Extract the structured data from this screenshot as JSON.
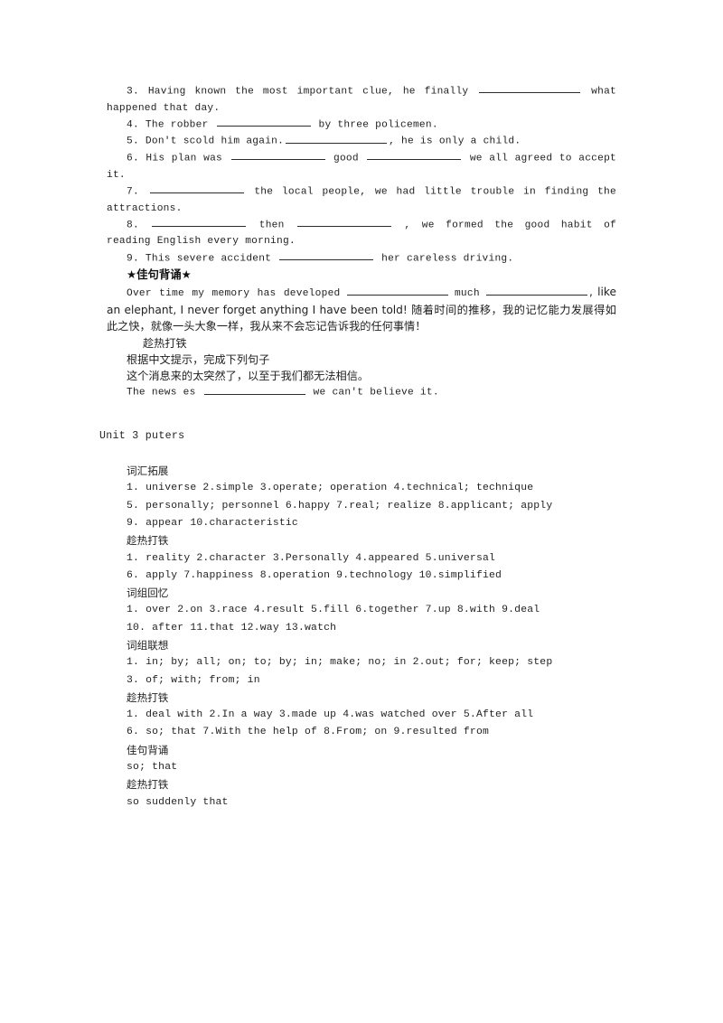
{
  "document": {
    "exercise_block": {
      "items": [
        {
          "number": "3.",
          "pre": "Having known the most important clue, he finally",
          "post": "what happened that day.",
          "blanks": 1
        },
        {
          "number": "4.",
          "pre": "The robber",
          "post": "by three policemen.",
          "blanks": 1
        },
        {
          "number": "5.",
          "pre": "Don't scold him again.",
          "post": ",  he is only a child.",
          "blanks": 1
        },
        {
          "number": "6.",
          "pre": "His plan was",
          "mid": "good",
          "post": "we all agreed to accept it.",
          "blanks": 2
        },
        {
          "number": "7.",
          "pre": "",
          "post": "the local people, we had little trouble in finding the attractions.",
          "blanks": 1
        },
        {
          "number": "8.",
          "pre": "",
          "mid": "then",
          "post": ",  we formed the good habit of reading English every morning.",
          "blanks": 2
        },
        {
          "number": "9.",
          "pre": "This severe accident",
          "post": "her careless driving.",
          "blanks": 1
        }
      ]
    },
    "good_sentence_section": {
      "heading": "★佳句背诵★",
      "sentence_part1": "Over time my memory has developed",
      "sentence_part2": "much",
      "sentence_part3": ", like an elephant, I never forget anything I have been told! 随着时间的推移，我的记忆能力发展得如此之快，就像一头大象一样，我从来不会忘记告诉我的任何事情！",
      "practice_heading": "趁热打铁",
      "instruction": "根据中文提示，完成下列句子",
      "chinese_prompt": "这个消息来的太突然了，以至于我们都无法相信。",
      "answer_line_pre": "The news es",
      "answer_line_post": "we can't believe it."
    },
    "unit": {
      "title": "Unit 3  puters"
    },
    "answers": {
      "sections": [
        {
          "heading": "词汇拓展",
          "lines": [
            "1. universe  2.simple  3.operate; operation  4.technical; technique",
            "5. personally; personnel  6.happy  7.real; realize  8.applicant; apply",
            "9. appear  10.characteristic"
          ]
        },
        {
          "heading": "趁热打铁",
          "lines": [
            "1. reality  2.character  3.Personally  4.appeared  5.universal",
            "6. apply  7.happiness  8.operation  9.technology  10.simplified"
          ]
        },
        {
          "heading": "词组回忆",
          "lines": [
            "1. over  2.on  3.race  4.result  5.fill  6.together  7.up  8.with  9.deal",
            "10. after  11.that  12.way  13.watch"
          ]
        },
        {
          "heading": "词组联想",
          "lines": [
            "1. in; by; all; on; to; by; in; make; no; in  2.out; for; keep; step",
            "3. of; with; from; in"
          ]
        },
        {
          "heading": "趁热打铁",
          "lines": [
            "1. deal with  2.In a way  3.made up  4.was watched over  5.After all",
            "6. so; that  7.With the help of  8.From; on  9.resulted from"
          ]
        },
        {
          "heading": "佳句背诵",
          "lines": [
            "so; that"
          ]
        },
        {
          "heading": "趁热打铁",
          "lines": [
            "so suddenly that"
          ]
        }
      ]
    }
  }
}
